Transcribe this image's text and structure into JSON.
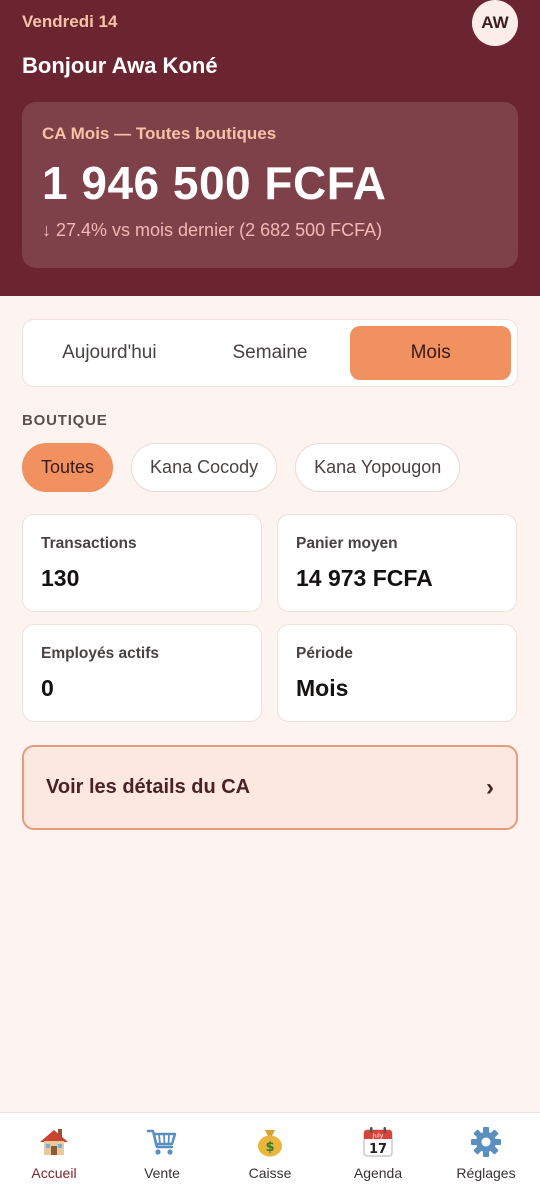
{
  "header": {
    "date": "Vendredi 14",
    "avatar_initials": "AW",
    "greeting": "Bonjour Awa Koné",
    "ca_label": "CA Mois — Toutes boutiques",
    "ca_amount": "1 946 500 FCFA",
    "ca_compare": "↓ 27.4% vs mois dernier (2 682 500 FCFA)"
  },
  "period_tabs": [
    {
      "label": "Aujourd'hui",
      "active": false
    },
    {
      "label": "Semaine",
      "active": false
    },
    {
      "label": "Mois",
      "active": true
    }
  ],
  "boutique": {
    "section_label": "BOUTIQUE",
    "chips": [
      {
        "label": "Toutes",
        "active": true
      },
      {
        "label": "Kana Cocody",
        "active": false
      },
      {
        "label": "Kana Yopougon",
        "active": false
      }
    ]
  },
  "stats": [
    {
      "label": "Transactions",
      "value": "130"
    },
    {
      "label": "Panier moyen",
      "value": "14 973 FCFA"
    },
    {
      "label": "Employés actifs",
      "value": "0"
    },
    {
      "label": "Période",
      "value": "Mois"
    }
  ],
  "details_button": {
    "label": "Voir les détails du CA",
    "chevron": "›"
  },
  "tabbar": [
    {
      "label": "Accueil",
      "icon": "house-icon",
      "active": true
    },
    {
      "label": "Vente",
      "icon": "cart-icon",
      "active": false
    },
    {
      "label": "Caisse",
      "icon": "money-bag-icon",
      "active": false
    },
    {
      "label": "Agenda",
      "icon": "calendar-icon",
      "active": false,
      "badge_day": "17",
      "badge_month": "July"
    },
    {
      "label": "Réglages",
      "icon": "gear-icon",
      "active": false
    }
  ],
  "colors": {
    "header_bg": "#6b2530",
    "accent": "#f0915f",
    "page_bg": "#fdf3f0"
  }
}
